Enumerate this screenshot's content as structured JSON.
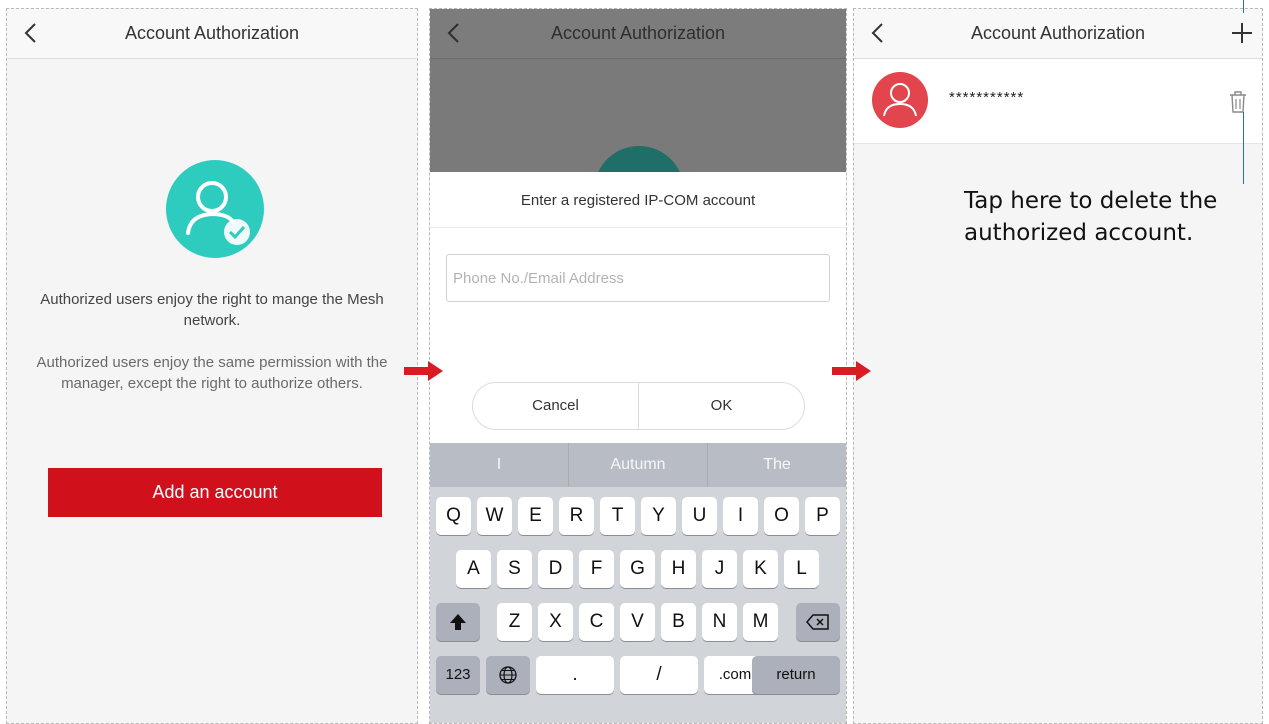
{
  "screens": [
    {
      "nav": {
        "title": "Account Authorization",
        "back_icon": "chevron-left-icon"
      },
      "desc1": "Authorized users enjoy the right to mange the Mesh network.",
      "desc2": "Authorized users enjoy the same permission with the manager, except the right to authorize others.",
      "add_button": "Add an account"
    },
    {
      "nav": {
        "title": "Account Authorization"
      },
      "dialog": {
        "title": "Enter a registered IP-COM account",
        "input_placeholder": "Phone No./Email Address",
        "input_value": "",
        "cancel": "Cancel",
        "ok": "OK"
      },
      "keyboard": {
        "suggestions": [
          "I",
          "Autumn",
          "The"
        ],
        "row1": [
          "Q",
          "W",
          "E",
          "R",
          "T",
          "Y",
          "U",
          "I",
          "O",
          "P"
        ],
        "row2": [
          "A",
          "S",
          "D",
          "F",
          "G",
          "H",
          "J",
          "K",
          "L"
        ],
        "row3": [
          "Z",
          "X",
          "C",
          "V",
          "B",
          "N",
          "M"
        ],
        "row4": {
          "num": "123",
          "dot": ".",
          "slash": "/",
          "com": ".com",
          "return": "return"
        }
      }
    },
    {
      "nav": {
        "title": "Account Authorization"
      },
      "account": {
        "name": "***********"
      }
    }
  ],
  "annotation": "Tap here to delete the authorized account.",
  "colors": {
    "brand_red": "#d0111b",
    "teal": "#2ecbbf",
    "avatar_red": "#e2454d",
    "callout_blue": "#2a6eb5"
  }
}
